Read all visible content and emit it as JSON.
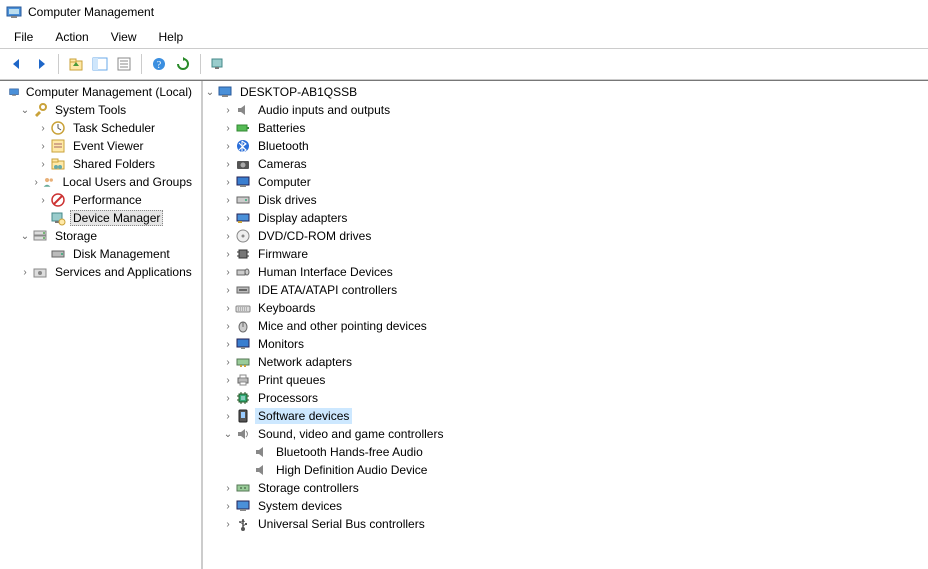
{
  "title": "Computer Management",
  "menu": {
    "file": "File",
    "action": "Action",
    "view": "View",
    "help": "Help"
  },
  "left": {
    "root": "Computer Management (Local)",
    "system_tools": "System Tools",
    "task_scheduler": "Task Scheduler",
    "event_viewer": "Event Viewer",
    "shared_folders": "Shared Folders",
    "local_users": "Local Users and Groups",
    "performance": "Performance",
    "device_manager": "Device Manager",
    "storage": "Storage",
    "disk_management": "Disk Management",
    "services_apps": "Services and Applications"
  },
  "right": {
    "computer": "DESKTOP-AB1QSSB",
    "audio_io": "Audio inputs and outputs",
    "batteries": "Batteries",
    "bluetooth": "Bluetooth",
    "cameras": "Cameras",
    "computer_cat": "Computer",
    "disk_drives": "Disk drives",
    "display_adapters": "Display adapters",
    "dvd": "DVD/CD-ROM drives",
    "firmware": "Firmware",
    "hid": "Human Interface Devices",
    "ide": "IDE ATA/ATAPI controllers",
    "keyboards": "Keyboards",
    "mice": "Mice and other pointing devices",
    "monitors": "Monitors",
    "network": "Network adapters",
    "print_queues": "Print queues",
    "processors": "Processors",
    "software_devices": "Software devices",
    "sound": "Sound, video and game controllers",
    "bt_handsfree": "Bluetooth Hands-free Audio",
    "hd_audio": "High Definition Audio Device",
    "storage_ctrl": "Storage controllers",
    "system_devices": "System devices",
    "usb": "Universal Serial Bus controllers"
  }
}
